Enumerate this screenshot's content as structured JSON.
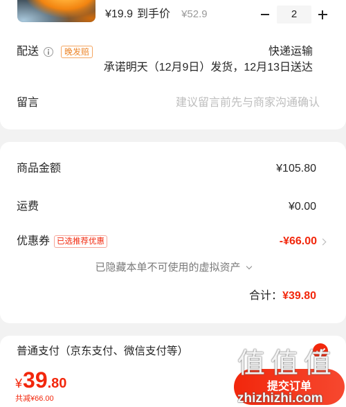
{
  "product": {
    "price": "¥19.9",
    "price_label": "到手价",
    "original_price": "¥52.9",
    "quantity": "2"
  },
  "delivery": {
    "label": "配送",
    "badge": "晚发赔",
    "method": "快递运输",
    "promise": "承诺明天（12月9日）发货，12月13日送达"
  },
  "message": {
    "label": "留言",
    "placeholder": "建议留言前先与商家沟通确认"
  },
  "summary": {
    "goods_label": "商品金额",
    "goods_value": "¥105.80",
    "shipping_label": "运费",
    "shipping_value": "¥0.00",
    "coupon_label": "优惠券",
    "coupon_badge": "已选推荐优惠",
    "coupon_value": "-¥66.00",
    "hidden_assets": "已隐藏本单不可使用的虚拟资产",
    "total_label": "合计：",
    "total_value": "¥39.80"
  },
  "payment": {
    "method": "普通支付（京东支付、微信支付等）",
    "selected": true
  },
  "footer": {
    "currency": "¥",
    "price_int": "39",
    "price_dec": ".80",
    "saved": "共减¥66.00",
    "submit": "提交订单"
  },
  "watermark": {
    "logo": "值值值",
    "site": "zhizhizhi.com"
  },
  "icons": {
    "minus": "minus-icon",
    "plus": "plus-icon",
    "info": "info-icon",
    "coupon_chevron": "chevron-right-icon",
    "hidden_chevron": "chevron-down-icon",
    "payment_check": "check-circle-icon"
  },
  "colors": {
    "accent": "#f2270c",
    "badge_orange": "#ec8427",
    "background": "#f2f2f2",
    "muted": "#9a9a9a"
  }
}
